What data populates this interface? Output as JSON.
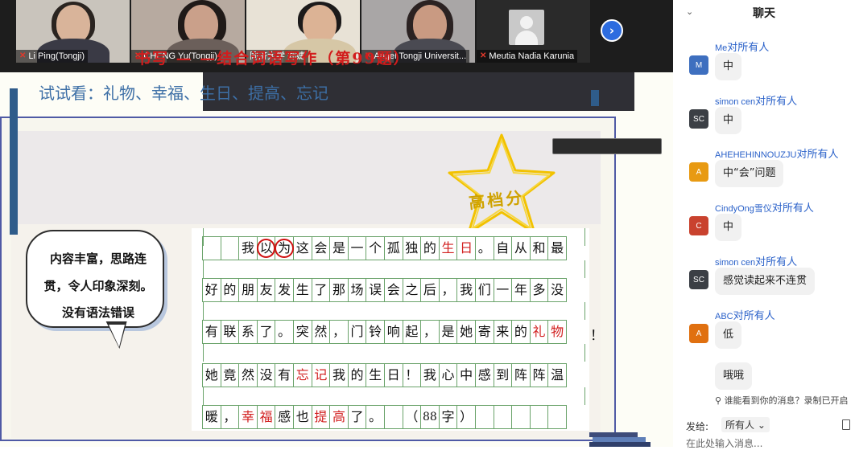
{
  "participants": [
    {
      "name": "Li Ping(Tongji)",
      "muted": true
    },
    {
      "name": "CHENG Yu(Tongji)",
      "muted": true
    },
    {
      "name": "同济大学 郑婕",
      "muted": false
    },
    {
      "name": "Angel Tongji Universit...",
      "muted": true
    },
    {
      "name": "Meutia Nadia Karunia",
      "muted": true
    }
  ],
  "next_icon": "chevron-right-icon",
  "slide": {
    "title": "书写 — —结合词语写作（第99题）",
    "try_line": "试试看：礼物、幸福、生日、提高、忘记",
    "badge": "高档分",
    "bubble_lines": [
      "内容丰富，思路连",
      "贯，令人印象深刻。",
      "没有语法错误"
    ],
    "grid_rows": [
      [
        "",
        "",
        "我",
        "以",
        "为",
        "这",
        "会",
        "是",
        "一",
        "个",
        "孤",
        "独",
        "的",
        "生",
        "日",
        "。",
        "自",
        "从",
        "和",
        "最"
      ],
      [
        "好",
        "的",
        "朋",
        "友",
        "发",
        "生",
        "了",
        "那",
        "场",
        "误",
        "会",
        "之",
        "后",
        "，",
        "我",
        "们",
        "一",
        "年",
        "多",
        "没"
      ],
      [
        "有",
        "联",
        "系",
        "了",
        "。",
        "突",
        "然",
        "，",
        "门",
        "铃",
        "响",
        "起",
        "，",
        "是",
        "她",
        "寄",
        "来",
        "的",
        "礼",
        "物"
      ],
      [
        "她",
        "竟",
        "然",
        "没",
        "有",
        "忘",
        "记",
        "我",
        "的",
        "生",
        "日",
        "！",
        "我",
        "心",
        "中",
        "感",
        "到",
        "阵",
        "阵",
        "温"
      ],
      [
        "暖",
        "，",
        "幸",
        "福",
        "感",
        "也",
        "提",
        "高",
        "了",
        "。",
        "",
        "（",
        "88",
        "字",
        "）",
        "",
        "",
        "",
        "",
        ""
      ]
    ],
    "trailing_mark": "！"
  },
  "chat": {
    "title": "聊天",
    "to_label": "对所有人",
    "messages": [
      {
        "sender": "Me",
        "initials": "M",
        "color": "#3e6fbf",
        "texts": [
          "中"
        ]
      },
      {
        "sender": "simon cen",
        "initials": "SC",
        "color": "#3b3f45",
        "texts": [
          "中"
        ]
      },
      {
        "sender": "AHEHEHINNOUZJU",
        "initials": "A",
        "color": "#e89a12",
        "texts": [
          "中“会”问题"
        ]
      },
      {
        "sender": "CindyOng雪仪",
        "initials": "C",
        "color": "#c9422e",
        "texts": [
          "中"
        ]
      },
      {
        "sender": "simon cen",
        "initials": "SC",
        "color": "#3b3f45",
        "texts": [
          "感觉读起来不连贯"
        ]
      },
      {
        "sender": "ABC",
        "initials": "A",
        "color": "#e07010",
        "texts": [
          "低",
          "哦哦"
        ]
      }
    ],
    "who_sees": "谁能看到你的消息？录制已开启",
    "send_label": "发给:",
    "send_target": "所有人",
    "input_placeholder": "在此处输入消息..."
  }
}
